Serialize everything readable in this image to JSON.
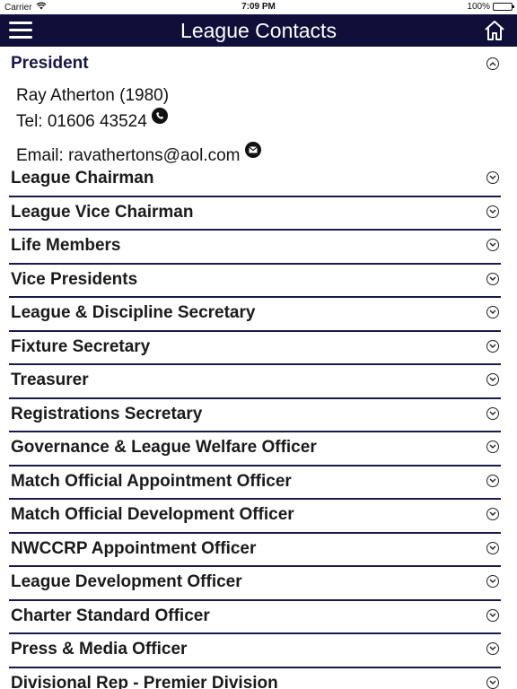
{
  "status_bar": {
    "carrier": "Carrier",
    "time": "7:09 PM",
    "battery": "100%"
  },
  "navbar": {
    "title": "League Contacts",
    "menu_icon": "hamburger-menu-icon",
    "home_icon": "home-icon"
  },
  "president": {
    "title": "President",
    "name": "Ray Atherton (1980)",
    "tel": "Tel: 01606 43524",
    "email": "Email: ravathertons@aol.com"
  },
  "sections": [
    "League Chairman",
    "League Vice Chairman",
    "Life Members",
    "Vice Presidents",
    "League & Discipline Secretary",
    "Fixture Secretary",
    "Treasurer",
    "Registrations Secretary",
    "Governance & League Welfare Officer",
    "Match Official Appointment Officer",
    "Match Official Development Officer",
    "NWCCRP Appointment Officer",
    "League Development Officer",
    "Charter Standard Officer",
    "Press & Media Officer",
    "Divisional Rep - Premier Division"
  ],
  "colors": {
    "navbar": "#0f0f3a",
    "divider": "#1a1a4a",
    "section_title": "#16164a"
  }
}
